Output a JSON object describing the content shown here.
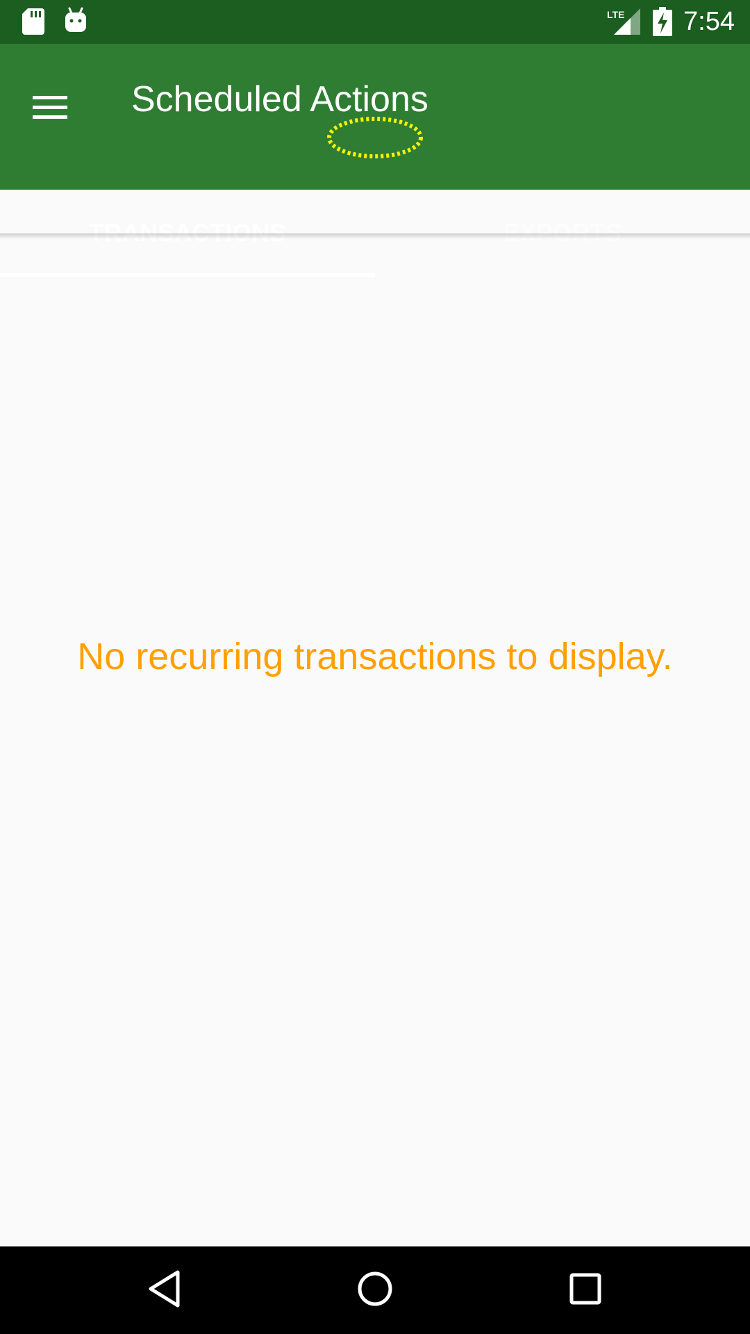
{
  "status_bar": {
    "time": "7:54",
    "network_label": "LTE",
    "icons": [
      "sd-card-icon",
      "android-debug-icon",
      "lte-signal-icon",
      "battery-charging-icon"
    ]
  },
  "app_bar": {
    "title": "Scheduled Actions",
    "menu_icon": "hamburger-menu-icon"
  },
  "tabs": [
    {
      "label": "TRANSACTIONS",
      "selected": true
    },
    {
      "label": "EXPORTS",
      "selected": false
    }
  ],
  "content": {
    "empty_message": "No recurring transactions to display."
  },
  "nav_bar": {
    "icons": [
      "back-icon",
      "home-icon",
      "recents-icon"
    ]
  },
  "colors": {
    "status_bar": "#1b5e20",
    "primary": "#2e7d32",
    "accent_text": "#ffa000",
    "background": "#fafafa",
    "nav_bar": "#000000"
  }
}
